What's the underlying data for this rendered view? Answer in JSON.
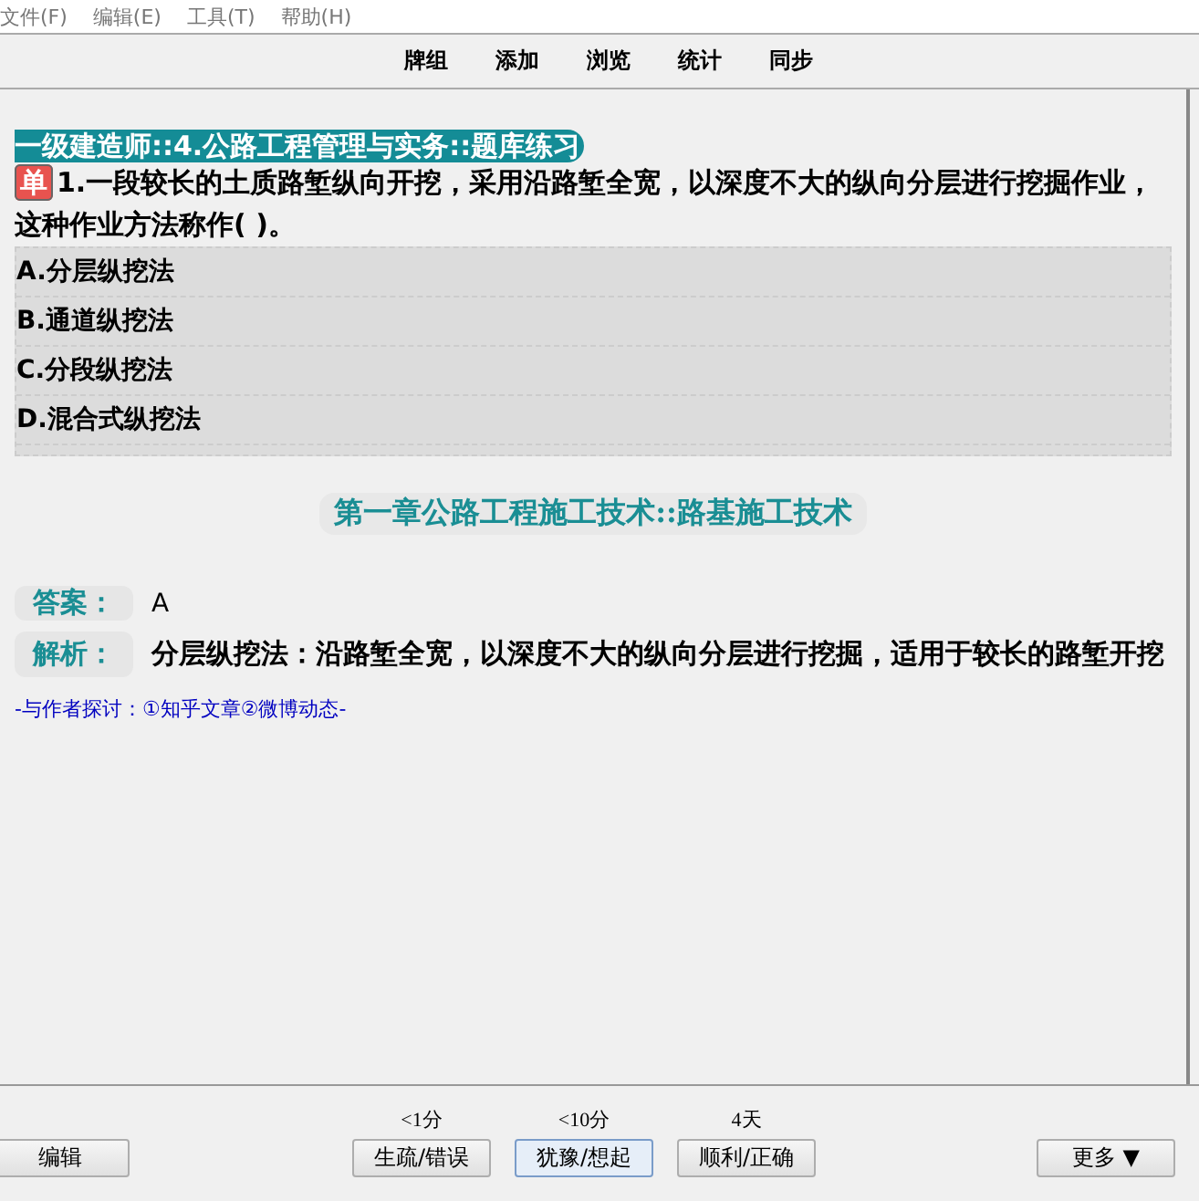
{
  "menu": [
    "文件(F)",
    "编辑(E)",
    "工具(T)",
    "帮助(H)"
  ],
  "toolbar": [
    "牌组",
    "添加",
    "浏览",
    "统计",
    "同步"
  ],
  "card": {
    "deck": "一级建造师::4.公路工程管理与实务::题库练习",
    "type_badge": "单",
    "question": "1.一段较长的土质路堑纵向开挖，采用沿路堑全宽，以深度不大的纵向分层进行挖掘作业，这种作业方法称作( )。",
    "options": [
      "A.分层纵挖法",
      "B.通道纵挖法",
      "C.分段纵挖法",
      "D.混合式纵挖法"
    ],
    "chapter": "第一章公路工程施工技术::路基施工技术",
    "answer_label": "答案：",
    "answer": "A",
    "analysis_label": "解析：",
    "analysis": "分层纵挖法：沿路堑全宽，以深度不大的纵向分层进行挖掘，适用于较长的路堑开挖",
    "footer_link": "-与作者探讨：①知乎文章②微博动态-"
  },
  "bottom": {
    "edit_button": "编辑",
    "answers": [
      {
        "interval": "<1分",
        "label": "生疏/错误",
        "selected": false
      },
      {
        "interval": "<10分",
        "label": "犹豫/想起",
        "selected": true
      },
      {
        "interval": "4天",
        "label": "顺利/正确",
        "selected": false
      }
    ],
    "more_button": "更多 ▼"
  }
}
